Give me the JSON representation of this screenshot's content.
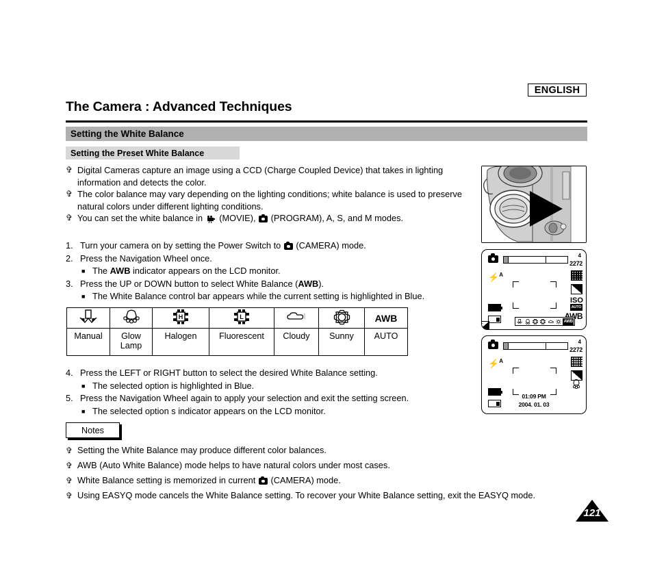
{
  "header": {
    "language_badge": "ENGLISH",
    "page_title": "The Camera : Advanced Techniques",
    "section_title": "Setting the White Balance",
    "subsection_title": "Setting the Preset White Balance"
  },
  "intro_bullets": [
    "Digital Cameras capture an image using a CCD (Charge Coupled Device) that takes in lighting information and detects the color.",
    "The color balance may vary depending on the lighting conditions; white balance is used to preserve natural colors under different lighting conditions.",
    "You can set the white balance in "
  ],
  "intro_bullet3": {
    "pre": "You can set the white balance in",
    "movie_label": "(MOVIE),",
    "program_label": "(PROGRAM), A, S, and M modes."
  },
  "steps": [
    {
      "num": "1.",
      "text": "Turn your camera on by setting the Power Switch to",
      "text_after_icon": "(CAMERA) mode.",
      "has_icon": true,
      "subs": []
    },
    {
      "num": "2.",
      "text": "Press the Navigation Wheel once.",
      "subs": [
        "The AWB indicator appears on the LCD monitor."
      ]
    },
    {
      "num": "3.",
      "text": "Press the UP or DOWN button to select White Balance (AWB).",
      "subs": [
        "The White Balance control bar appears while the current setting is highlighted in Blue."
      ]
    }
  ],
  "steps_after": [
    {
      "num": "4.",
      "text": "Press the LEFT or RIGHT button to select the desired White Balance setting.",
      "subs": [
        "The selected option is highlighted in Blue."
      ]
    },
    {
      "num": "5.",
      "text": "Press the Navigation Wheel again to apply your selection and exit the setting screen.",
      "subs": [
        "The selected option s indicator appears on the LCD monitor."
      ]
    }
  ],
  "wb_table": {
    "icons": [
      "manual-wb-icon",
      "glow-lamp-icon",
      "halogen-icon",
      "fluorescent-icon",
      "cloudy-icon",
      "sunny-icon",
      "awb-text"
    ],
    "awb_icon_label": "AWB",
    "labels": [
      "Manual",
      "Glow Lamp",
      "Halogen",
      "Fluorescent",
      "Cloudy",
      "Sunny",
      "AUTO"
    ]
  },
  "notes": {
    "title": "Notes",
    "items": [
      "Setting the White Balance may produce different color balances.",
      "AWB (Auto White Balance) mode helps to have natural colors under most cases.",
      "White Balance setting is memorized in current",
      "Using EASYQ mode cancels the White Balance setting. To recover your White Balance setting, exit the EASYQ mode."
    ],
    "item3_after_icon": "(CAMERA) mode."
  },
  "lcd1": {
    "count": "4",
    "resolution": "2272",
    "flash": "A",
    "iso": "ISO",
    "iso_sub": "AUTO",
    "awb": "AWB",
    "control_bar_selected": "AWB",
    "control_bar_cells": [
      "manual",
      "glow",
      "halogen",
      "fluorescent",
      "cloudy",
      "sunny",
      "AWB"
    ]
  },
  "lcd2": {
    "count": "4",
    "resolution": "2272",
    "flash": "A",
    "time": "01:09 PM",
    "date": "2004. 01. 03"
  },
  "footer": {
    "page_number": "121"
  },
  "colors": {
    "section_bar": "#b0b0b0",
    "subsection_bar": "#d8d8d8",
    "text": "#000000",
    "background": "#ffffff"
  }
}
